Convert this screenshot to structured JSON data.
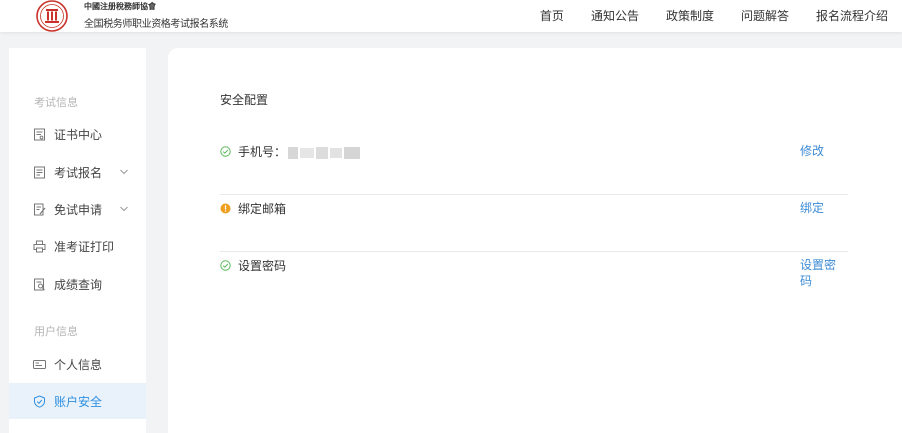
{
  "header": {
    "logo_title": "中國注册稅務師協會",
    "logo_subtitle": "全国税务师职业资格考试报名系统",
    "nav": [
      "首页",
      "通知公告",
      "政策制度",
      "问题解答",
      "报名流程介绍"
    ]
  },
  "sidebar": {
    "section_exam": "考试信息",
    "section_user": "用户信息",
    "items": [
      {
        "label": "证书中心",
        "icon": "certificate-icon"
      },
      {
        "label": "考试报名",
        "icon": "exam-form-icon",
        "expandable": true
      },
      {
        "label": "免试申请",
        "icon": "exemption-edit-icon",
        "expandable": true
      },
      {
        "label": "准考证打印",
        "icon": "printer-icon"
      },
      {
        "label": "成绩查询",
        "icon": "score-search-icon"
      },
      {
        "label": "个人信息",
        "icon": "id-card-icon"
      },
      {
        "label": "账户安全",
        "icon": "shield-icon",
        "active": true
      }
    ]
  },
  "main": {
    "title": "安全配置",
    "rows": [
      {
        "label": "手机号：",
        "status": "ok",
        "action": "修改"
      },
      {
        "label": "绑定邮箱",
        "status": "warning",
        "action": "绑定"
      },
      {
        "label": "设置密码",
        "status": "ok",
        "action": "设置密码"
      }
    ]
  },
  "colors": {
    "accent": "#2f8fe0",
    "link": "#3e8bd5",
    "ok": "#5cb85c",
    "warning": "#f0a020",
    "active_bg": "#e9f2fb",
    "page_bg": "#f2f3f5",
    "emblem": "#c8322a"
  }
}
